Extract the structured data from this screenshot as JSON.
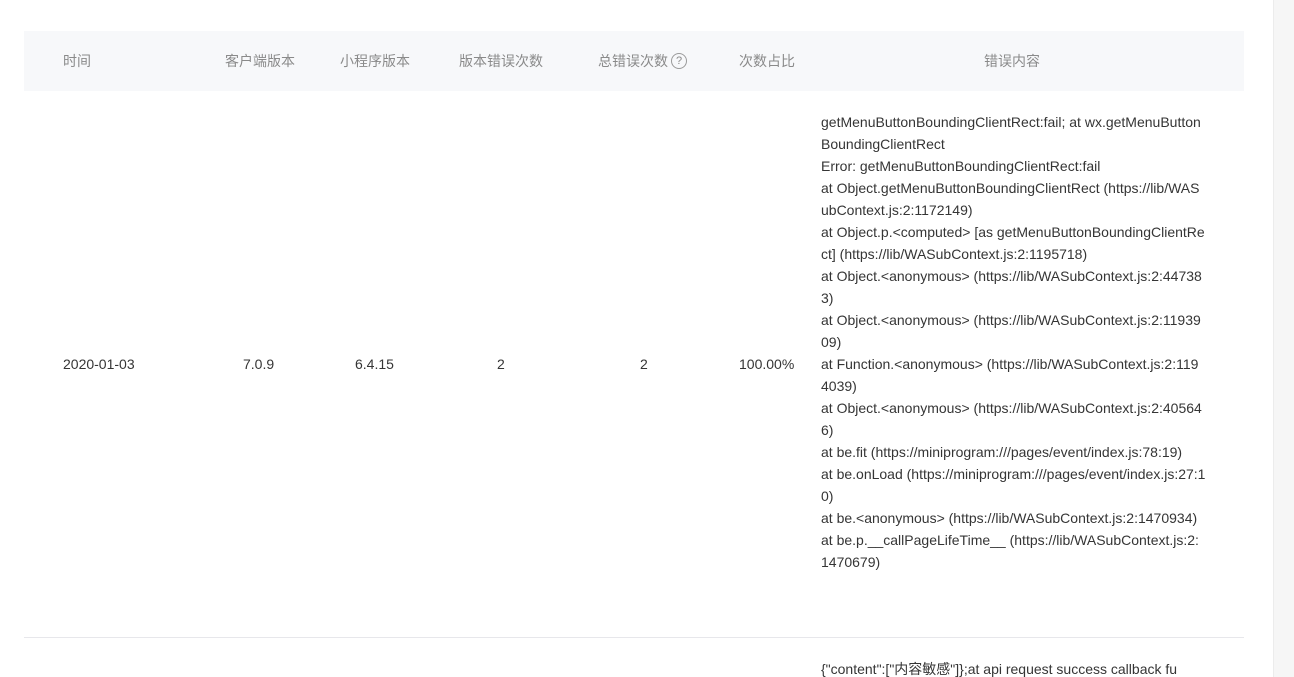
{
  "table": {
    "headers": {
      "time": "时间",
      "client_version": "客户端版本",
      "miniprogram_version": "小程序版本",
      "version_error_count": "版本错误次数",
      "total_error_count": "总错误次数",
      "ratio": "次数占比",
      "error_content": "错误内容"
    },
    "help_icon_glyph": "?",
    "rows": [
      {
        "time": "2020-01-03",
        "client_version": "7.0.9",
        "miniprogram_version": "6.4.15",
        "version_error_count": "2",
        "total_error_count": "2",
        "ratio": "100.00%",
        "error_lines": [
          "getMenuButtonBoundingClientRect:fail; at wx.getMenuButtonBoundingClientRect",
          "Error: getMenuButtonBoundingClientRect:fail",
          "at Object.getMenuButtonBoundingClientRect (https://lib/WASubContext.js:2:1172149)",
          "at Object.p.<computed> [as getMenuButtonBoundingClientRect] (https://lib/WASubContext.js:2:1195718)",
          "at Object.<anonymous> (https://lib/WASubContext.js:2:447383)",
          "at Object.<anonymous> (https://lib/WASubContext.js:2:1193909)",
          "at Function.<anonymous> (https://lib/WASubContext.js:2:1194039)",
          "at Object.<anonymous> (https://lib/WASubContext.js:2:405646)",
          "at be.fit (https://miniprogram:///pages/event/index.js:78:19)",
          "at be.onLoad (https://miniprogram:///pages/event/index.js:27:10)",
          "at be.<anonymous> (https://lib/WASubContext.js:2:1470934)",
          "at be.p.__callPageLifeTime__ (https://lib/WASubContext.js:2:1470679)"
        ]
      },
      {
        "error_lines": [
          "{\"content\":[\"内容敏感\"]};at api request success callback fu"
        ]
      }
    ]
  }
}
